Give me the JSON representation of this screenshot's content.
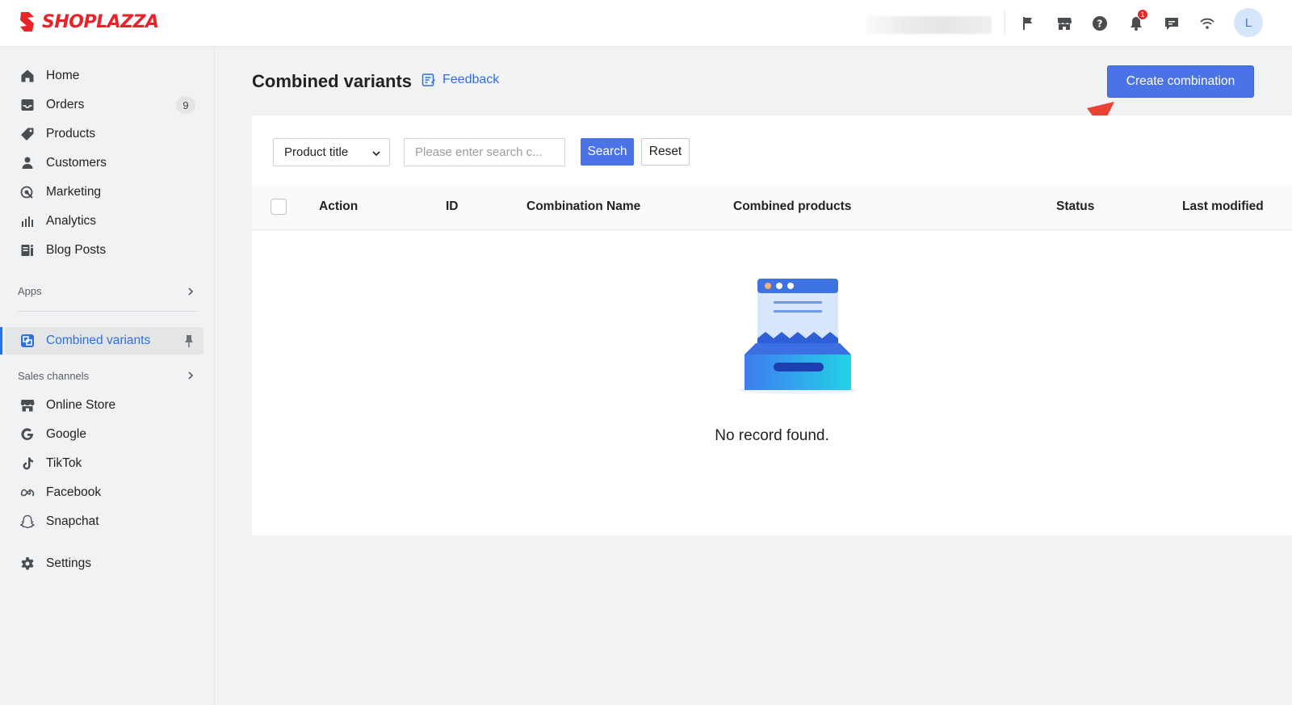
{
  "brand": {
    "name": "SHOPLAZZA",
    "color": "#e8232a"
  },
  "topbar": {
    "icons": [
      "flag-icon",
      "store-icon",
      "help-icon",
      "bell-icon",
      "chat-icon",
      "wifi-icon"
    ],
    "notification_count": "1",
    "avatar_initial": "L"
  },
  "sidebar": {
    "items": [
      {
        "label": "Home",
        "icon": "home-icon"
      },
      {
        "label": "Orders",
        "icon": "inbox-icon",
        "badge": "9"
      },
      {
        "label": "Products",
        "icon": "tag-icon"
      },
      {
        "label": "Customers",
        "icon": "person-icon"
      },
      {
        "label": "Marketing",
        "icon": "target-icon"
      },
      {
        "label": "Analytics",
        "icon": "bar-chart-icon"
      },
      {
        "label": "Blog Posts",
        "icon": "blog-icon"
      }
    ],
    "apps_label": "Apps",
    "active_app": {
      "label": "Combined variants",
      "icon": "combined-variants-icon"
    },
    "sales_channels_label": "Sales channels",
    "channels": [
      {
        "label": "Online Store",
        "icon": "store-icon"
      },
      {
        "label": "Google",
        "icon": "google-icon"
      },
      {
        "label": "TikTok",
        "icon": "tiktok-icon"
      },
      {
        "label": "Facebook",
        "icon": "meta-icon"
      },
      {
        "label": "Snapchat",
        "icon": "ghost-icon"
      }
    ],
    "settings_label": "Settings",
    "accent_color": "#2f6fe0"
  },
  "main": {
    "title": "Combined variants",
    "feedback_label": "Feedback",
    "create_button": "Create combination",
    "filter": {
      "select_value": "Product title",
      "search_placeholder": "Please enter search c...",
      "search_button": "Search",
      "reset_button": "Reset"
    },
    "table": {
      "columns": [
        "Action",
        "ID",
        "Combination Name",
        "Combined products",
        "Status",
        "Last modified"
      ]
    },
    "empty_text": "No record found."
  }
}
